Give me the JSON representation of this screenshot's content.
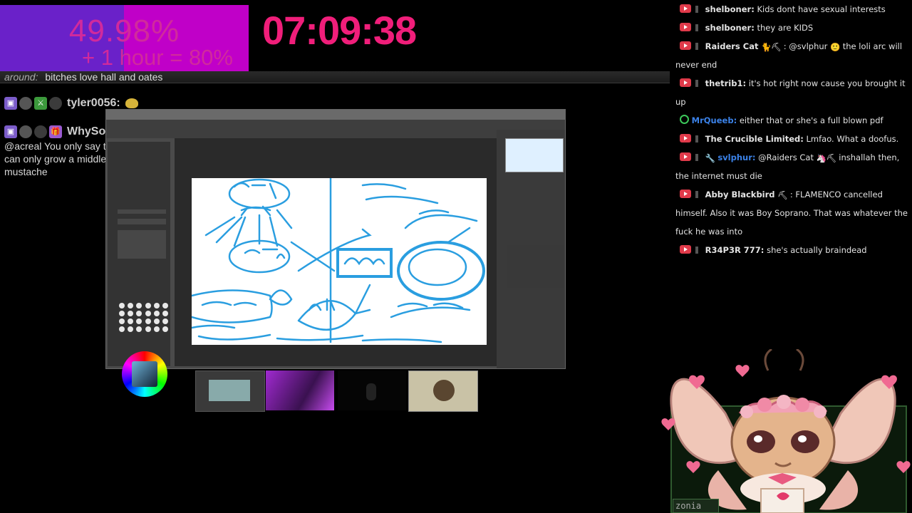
{
  "progress": {
    "percent_text": "49.98%",
    "percent_value": 49.98,
    "bonus_text": "+ 1 hour = 80%",
    "colors": {
      "filled": "#6a21c9",
      "remaining": "#c000c8",
      "text": "#d12a9c"
    }
  },
  "timer": {
    "text": "07:09:38",
    "color": "#f01e7a"
  },
  "alert": {
    "user": "around:",
    "message": "bitches love hall and oates"
  },
  "left_chat": [
    {
      "name": "tyler0056:",
      "message": ""
    },
    {
      "name": "WhySoDankness:",
      "message": "@acreal You only say that because you can only grow a middle school mustache"
    }
  ],
  "right_chat": [
    {
      "badge": "red",
      "name": "shelboner:",
      "text": "Kids dont have sexual interests"
    },
    {
      "badge": "red",
      "name": "shelboner:",
      "text": "they are KIDS"
    },
    {
      "badge": "red",
      "name": "Raiders Cat",
      "text": ": @svlphur",
      "text2": "the loli arc will never end"
    },
    {
      "badge": "red",
      "name": "thetrib1:",
      "text": "it's hot right now cause you brought it up"
    },
    {
      "badge": "green",
      "name": "MrQueeb:",
      "name_color": "blue",
      "text": "either that or she's a full blown pdf"
    },
    {
      "badge": "red",
      "name": "The Crucible Limited:",
      "text": "Lmfao. What a doofus."
    },
    {
      "badge": "red",
      "name": "svlphur:",
      "name_color": "blue",
      "text": "@Raiders Cat",
      "text2": "inshallah then, the internet must die"
    },
    {
      "badge": "red",
      "name": "Abby Blackbird",
      "text": ": FLAMENCO cancelled himself. Also it was Boy Soprano. That was whatever the fuck he was into"
    },
    {
      "badge": "red",
      "name": "R34P3R 777:",
      "text": "she's actually braindead"
    }
  ],
  "avatar": {
    "name_tag": "zonia"
  },
  "icons": [
    "twitch-badge-icon",
    "gift-icon",
    "sword-icon",
    "emote-icon",
    "hammer-icon",
    "unicorn-icon",
    "smiley-icon"
  ]
}
